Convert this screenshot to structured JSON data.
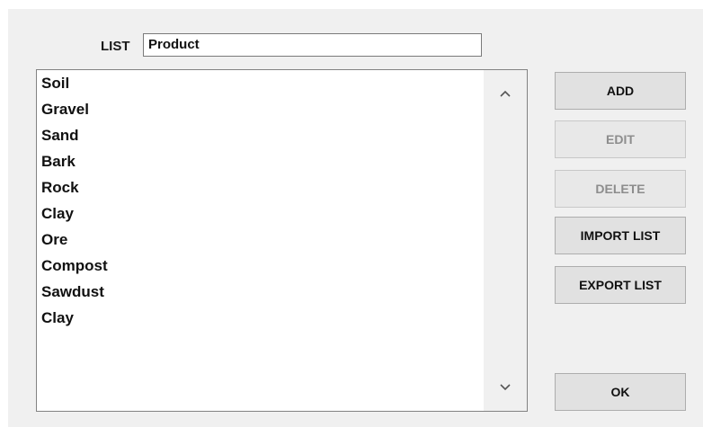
{
  "list_label": "LIST",
  "list_name_value": "Product",
  "items": [
    "Soil",
    "Gravel",
    "Sand",
    "Bark",
    "Rock",
    "Clay",
    "Ore",
    "Compost",
    "Sawdust",
    "Clay"
  ],
  "buttons": {
    "add": "ADD",
    "edit": "EDIT",
    "delete": "DELETE",
    "import_list": "IMPORT LIST",
    "export_list": "EXPORT LIST",
    "ok": "OK"
  },
  "button_states": {
    "edit_enabled": false,
    "delete_enabled": false
  },
  "icons": {
    "scroll_up": "chevron-up-icon",
    "scroll_down": "chevron-down-icon"
  },
  "colors": {
    "dialog_background": "#f0f0f0",
    "button_face": "#e1e1e1",
    "disabled_text": "#8d8d8d"
  }
}
